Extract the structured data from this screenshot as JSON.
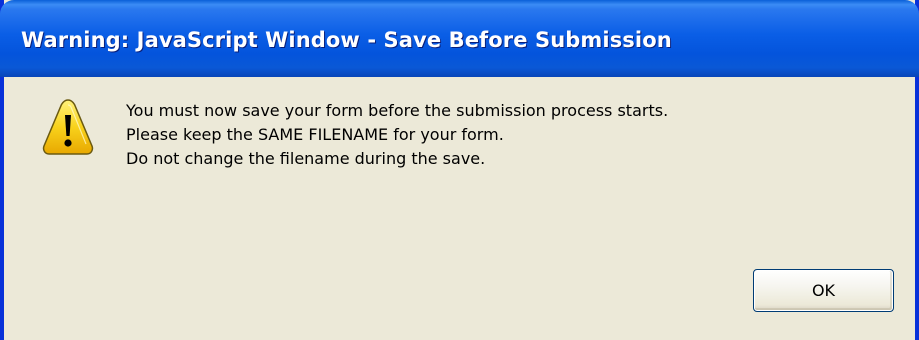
{
  "window": {
    "title": "Warning: JavaScript Window - Save Before Submission"
  },
  "dialog": {
    "icon": "warning-icon",
    "message_lines": [
      "You must now save your form before the submission process starts.",
      "Please keep the SAME FILENAME for your form.",
      "Do not change the filename during the save."
    ],
    "ok_label": "OK"
  },
  "colors": {
    "titlebar": "#0a5ee6",
    "window_border": "#0831d9",
    "dialog_background": "#ece9d8",
    "warning_yellow": "#f6c500"
  }
}
